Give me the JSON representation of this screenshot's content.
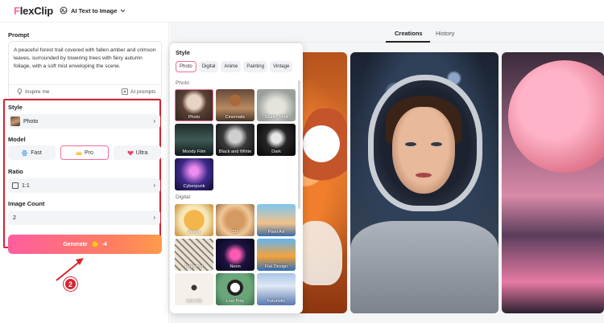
{
  "app": {
    "logo": "FlexClip",
    "tool_switch": "AI Text to Image"
  },
  "left_panel": {
    "prompt_label": "Prompt",
    "prompt_text": "A peaceful forest trail covered with fallen amber and crimson leaves, surrounded by towering trees with fiery autumn foliage, with a soft mist enveloping the scene.",
    "inspire_label": "Inspire me",
    "ai_prompts_label": "AI prompts",
    "style_label": "Style",
    "style_value": "Photo",
    "model_label": "Model",
    "models": [
      {
        "label": "Fast",
        "selected": false
      },
      {
        "label": "Pro",
        "selected": true
      },
      {
        "label": "Ultra",
        "selected": false
      }
    ],
    "ratio_label": "Ratio",
    "ratio_value": "1:1",
    "count_label": "Image Count",
    "count_value": "2",
    "generate_label": "Generate",
    "generate_cost": "-4",
    "annotation_step": "2"
  },
  "right_panel": {
    "tabs": [
      {
        "label": "Creations",
        "active": true
      },
      {
        "label": "History",
        "active": false
      }
    ]
  },
  "style_popup": {
    "title": "Style",
    "chips": [
      {
        "label": "Photo",
        "selected": true
      },
      {
        "label": "Digital",
        "selected": false
      },
      {
        "label": "Anime",
        "selected": false
      },
      {
        "label": "Painting",
        "selected": false
      },
      {
        "label": "Vintage",
        "selected": false
      }
    ],
    "photo_label": "Photo",
    "photo_styles": [
      "Photo",
      "Cinematic",
      "Studio Shot",
      "Moody Film",
      "Black and White",
      "Dark",
      "Cyberpunk"
    ],
    "digital_label": "Digital",
    "digital_styles": [
      "Vector",
      "3D",
      "Pixel Art",
      "Papercut",
      "Neon",
      "Flat Design",
      "Line Art",
      "Low Poly",
      "Futuristic"
    ]
  },
  "colors": {
    "accent_pink": "#f36c93",
    "annotation_red": "#d6232f",
    "generate_gradient_start": "#ff5d9e",
    "generate_gradient_end": "#ff9a4a"
  }
}
